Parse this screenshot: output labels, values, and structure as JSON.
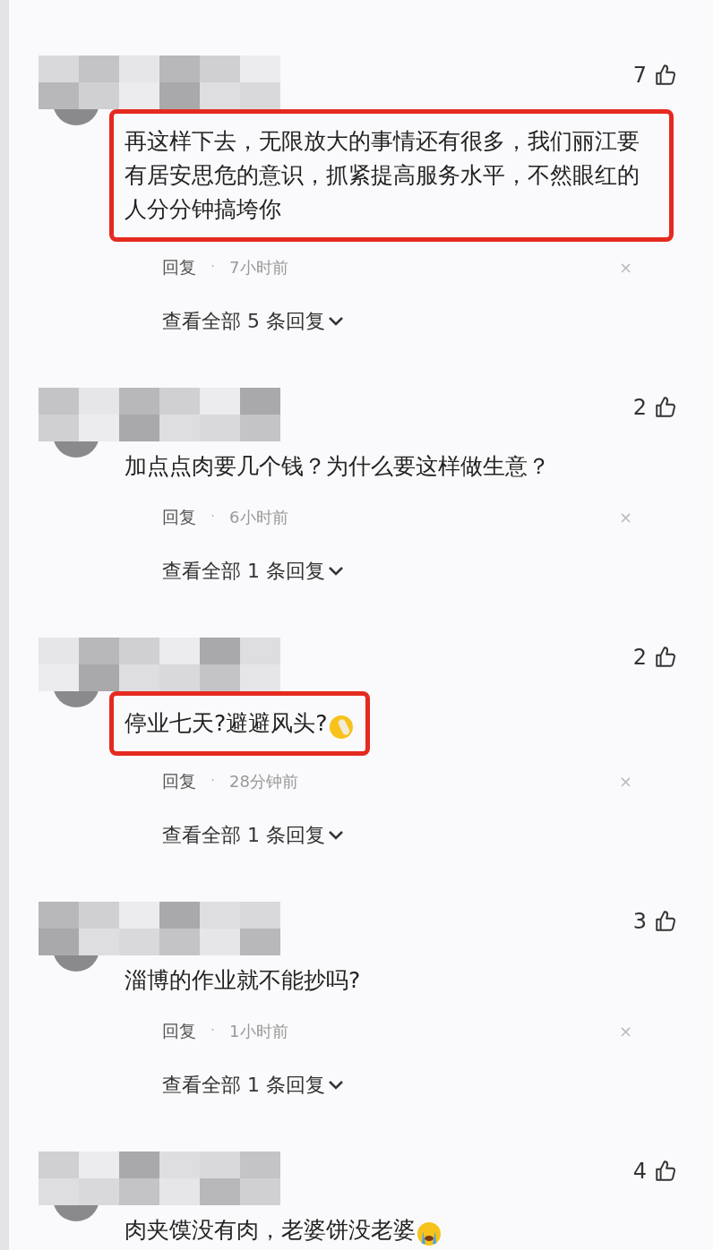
{
  "comments": [
    {
      "likes": "7",
      "text": "再这样下去，无限放大的事情还有很多，我们丽江要有居安思危的意识，抓紧提高服务水平，不然眼红的人分分钟搞垮你",
      "kind": "plain",
      "highlighted": true,
      "reply_label": "回复",
      "separator": "·",
      "time": "7小时前",
      "close": "×",
      "view_replies": "查看全部 5 条回复"
    },
    {
      "likes": "2",
      "text": "加点点肉要几个钱？为什么要这样做生意？",
      "kind": "plain",
      "highlighted": false,
      "reply_label": "回复",
      "separator": "·",
      "time": "6小时前",
      "close": "×",
      "view_replies": "查看全部 1 条回复"
    },
    {
      "likes": "2",
      "text": "停业七天?避避风头?",
      "kind": "facepalm",
      "highlighted": true,
      "reply_label": "回复",
      "separator": "·",
      "time": "28分钟前",
      "close": "×",
      "view_replies": "查看全部 1 条回复"
    },
    {
      "likes": "3",
      "text": "淄博的作业就不能抄吗?",
      "kind": "plain",
      "highlighted": false,
      "reply_label": "回复",
      "separator": "·",
      "time": "1小时前",
      "close": "×",
      "view_replies": "查看全部 1 条回复"
    },
    {
      "likes": "4",
      "text": "肉夹馍没有肉，老婆饼没老婆",
      "kind": "crying",
      "highlighted": false
    }
  ]
}
